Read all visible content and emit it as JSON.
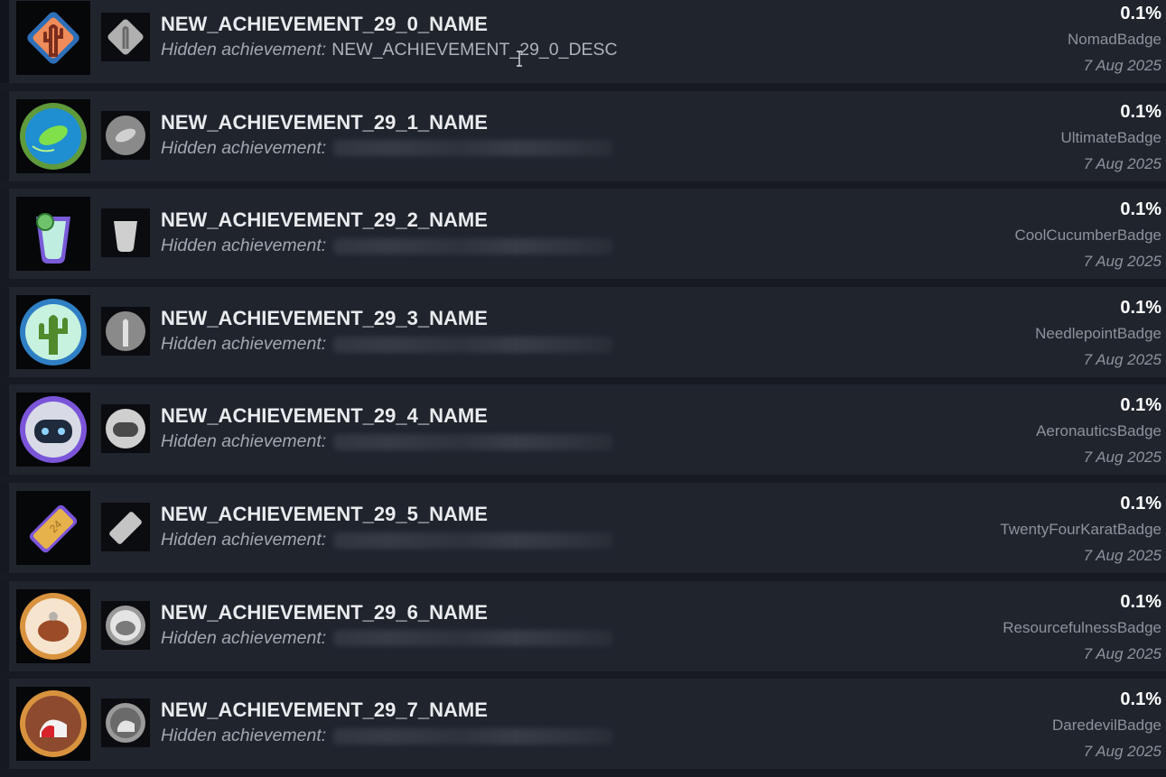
{
  "achievements": [
    {
      "name": "NEW_ACHIEVEMENT_29_0_NAME",
      "desc_prefix": "Hidden achievement:",
      "desc": "NEW_ACHIEVEMENT_29_0_DESC",
      "desc_visible": true,
      "percent": "0.1%",
      "badge": "NomadBadge",
      "date": "7 Aug 2025",
      "icon": "cactus-badge-icon",
      "accent": "#e86a3f"
    },
    {
      "name": "NEW_ACHIEVEMENT_29_1_NAME",
      "desc_prefix": "Hidden achievement:",
      "desc": "",
      "desc_visible": false,
      "percent": "0.1%",
      "badge": "UltimateBadge",
      "date": "7 Aug 2025",
      "icon": "frisbee-badge-icon",
      "accent": "#2a8fcb"
    },
    {
      "name": "NEW_ACHIEVEMENT_29_2_NAME",
      "desc_prefix": "Hidden achievement:",
      "desc": "",
      "desc_visible": false,
      "percent": "0.1%",
      "badge": "CoolCucumberBadge",
      "date": "7 Aug 2025",
      "icon": "cucumber-drink-badge-icon",
      "accent": "#7b5fd6"
    },
    {
      "name": "NEW_ACHIEVEMENT_29_3_NAME",
      "desc_prefix": "Hidden achievement:",
      "desc": "",
      "desc_visible": false,
      "percent": "0.1%",
      "badge": "NeedlepointBadge",
      "date": "7 Aug 2025",
      "icon": "needlepoint-cactus-badge-icon",
      "accent": "#2c7fc0"
    },
    {
      "name": "NEW_ACHIEVEMENT_29_4_NAME",
      "desc_prefix": "Hidden achievement:",
      "desc": "",
      "desc_visible": false,
      "percent": "0.1%",
      "badge": "AeronauticsBadge",
      "date": "7 Aug 2025",
      "icon": "astronaut-helmet-badge-icon",
      "accent": "#7a55d8"
    },
    {
      "name": "NEW_ACHIEVEMENT_29_5_NAME",
      "desc_prefix": "Hidden achievement:",
      "desc": "",
      "desc_visible": false,
      "percent": "0.1%",
      "badge": "TwentyFourKaratBadge",
      "date": "7 Aug 2025",
      "icon": "gold-bar-badge-icon",
      "accent": "#d6a94a"
    },
    {
      "name": "NEW_ACHIEVEMENT_29_6_NAME",
      "desc_prefix": "Hidden achievement:",
      "desc": "",
      "desc_visible": false,
      "percent": "0.1%",
      "badge": "ResourcefulnessBadge",
      "date": "7 Aug 2025",
      "icon": "roast-turkey-badge-icon",
      "accent": "#d99a44"
    },
    {
      "name": "NEW_ACHIEVEMENT_29_7_NAME",
      "desc_prefix": "Hidden achievement:",
      "desc": "",
      "desc_visible": false,
      "percent": "0.1%",
      "badge": "DaredevilBadge",
      "date": "7 Aug 2025",
      "icon": "daredevil-badge-icon",
      "accent": "#d99a44"
    }
  ],
  "colors": {
    "background": "#171a21",
    "row": "#1f242d",
    "title": "#e9ebee",
    "muted": "#8d939b",
    "percent": "#ffffff"
  }
}
